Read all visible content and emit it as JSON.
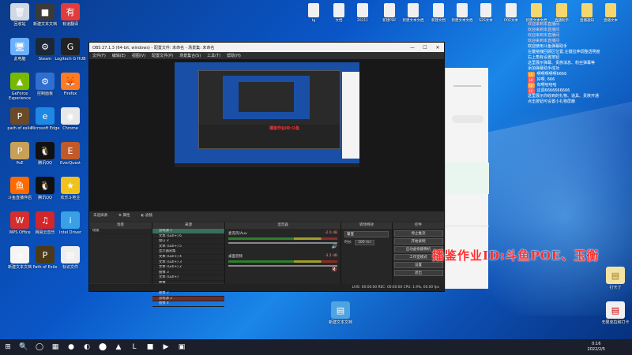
{
  "desktop_left": [
    {
      "label": "回收站",
      "color": "#cfd8e3",
      "glyph": "🗑"
    },
    {
      "label": "新建文本文档",
      "color": "#3a3a3a",
      "glyph": "■"
    },
    {
      "label": "有道翻译",
      "color": "#e23b3b",
      "glyph": "有"
    },
    {
      "label": "此电脑",
      "color": "#6ab0ff",
      "glyph": "🖥"
    },
    {
      "label": "Steam",
      "color": "#1b2838",
      "glyph": "⚙"
    },
    {
      "label": "Logitech G HUB",
      "color": "#222",
      "glyph": "G"
    },
    {
      "label": "GeForce Experience",
      "color": "#76b900",
      "glyph": "▲"
    },
    {
      "label": "控制面板",
      "color": "#2f6fd0",
      "glyph": "⚙"
    },
    {
      "label": "Firefox",
      "color": "#ff7b22",
      "glyph": "🦊"
    },
    {
      "label": "path of exile",
      "color": "#6b4a2a",
      "glyph": "P"
    },
    {
      "label": "Microsoft Edge",
      "color": "#1e88e5",
      "glyph": "e"
    },
    {
      "label": "Chrome",
      "color": "#e8e8e8",
      "glyph": "◉"
    },
    {
      "label": "PoE",
      "color": "#c9a05a",
      "glyph": "P"
    },
    {
      "label": "腾讯QQ",
      "color": "#111",
      "glyph": "🐧"
    },
    {
      "label": "EverQuest",
      "color": "#c05a2a",
      "glyph": "E"
    },
    {
      "label": "斗鱼直播伴侣",
      "color": "#ff6a00",
      "glyph": "鱼"
    },
    {
      "label": "腾讯QQ",
      "color": "#111",
      "glyph": "🐧"
    },
    {
      "label": "欢乐斗地主",
      "color": "#f2c21c",
      "glyph": "★"
    },
    {
      "label": "WPS Office",
      "color": "#d32f2f",
      "glyph": "W"
    },
    {
      "label": "网易云音乐",
      "color": "#d2262d",
      "glyph": "♫"
    },
    {
      "label": "Intel Driver",
      "color": "#3aa0e6",
      "glyph": "i"
    },
    {
      "label": "新建文本文档",
      "color": "#f5f5f5",
      "glyph": "e"
    },
    {
      "label": "Path of Exile",
      "color": "#4a3a1a",
      "glyph": "P"
    },
    {
      "label": "标识文件",
      "color": "#eee",
      "glyph": "▤"
    }
  ],
  "desktop_top": [
    "tg",
    "文档",
    "20211",
    "新建PDF",
    "新建文本文档",
    "新建文档",
    "新建文本文档",
    "S2S文本",
    "POE文本",
    "新建文本文档",
    "直播助手",
    "直播通知",
    "直播文本",
    "直播文件"
  ],
  "obs": {
    "title": "OBS 27.1.3 (64-bit, windows) - 配置文件: 未命名 - 场景集: 未命名",
    "menu": [
      "文件(F)",
      "编辑(E)",
      "视图(V)",
      "配置文件(P)",
      "场景集合(S)",
      "工具(T)",
      "帮助(H)"
    ],
    "preview_label": "未选择源",
    "preview_btns": [
      "属性",
      "滤镜"
    ],
    "panes": {
      "scenes": {
        "title": "场景",
        "items": [
          "场景"
        ]
      },
      "sources": {
        "title": "来源",
        "items": [
          "游戏源 1",
          "文本 (GDI+) 6",
          "窗口 2",
          "文本 (GDI+) 5",
          "显示器采集",
          "文本 (GDI+) 4",
          "文本 (GDI+) 3",
          "文本 (GDI+) 2",
          "图像 3",
          "文本 (GDI+)",
          "图像",
          "显示器采集",
          "图像 2",
          "游戏源 2",
          "图像 4"
        ]
      },
      "mixer": {
        "title": "混音器",
        "tracks": [
          {
            "name": "麦克风/Aux",
            "db": "-2.0 dB"
          },
          {
            "name": "桌面音频",
            "db": "-3.2 dB"
          }
        ]
      },
      "transitions": {
        "title": "转场特效",
        "type": "渐变",
        "duration_label": "时长",
        "duration": "300 ms"
      },
      "controls": {
        "title": "控件",
        "buttons": [
          "停止推流",
          "开始录制",
          "启动虚拟摄像机",
          "工作室模式",
          "设置",
          "退出"
        ]
      }
    },
    "status": "LIVE: 00:00:00    REC: 00:00:00    CPU: 1.9%, 60.00 fps"
  },
  "chat": {
    "lines": [
      {
        "badge": "",
        "user": "",
        "text": "欢迎来到本直播间"
      },
      {
        "badge": "",
        "user": "",
        "text": "欢迎来到本直播间"
      },
      {
        "badge": "",
        "user": "",
        "text": "欢迎来到本直播间"
      },
      {
        "badge": "",
        "user": "",
        "text": "欢迎来到本直播间"
      },
      {
        "badge": "",
        "user": "",
        "text": ""
      },
      {
        "badge": "",
        "user": "",
        "text": "欢迎使用斗鱼弹幕助手"
      },
      {
        "badge": "",
        "user": "",
        "text": "左键拖拽回顾区位置,左键拉伸调整透明度"
      },
      {
        "badge": "",
        "user": "",
        "text": "右上角有设置按钮"
      },
      {
        "badge": "",
        "user": "",
        "text": "这里展示弹幕、贵族消息、粉丝弹幕等"
      },
      {
        "badge": "",
        "user": "",
        "text": "添加弹幕助手成功"
      },
      {
        "badge": "LV",
        "user": "",
        "text": "啊啊啊啊啊6666"
      },
      {
        "badge": "LV",
        "user": "",
        "text": "好啊, 666"
      },
      {
        "badge": "LV",
        "user": "",
        "text": "有啊哈哈哈"
      },
      {
        "badge": "LV",
        "user": "",
        "text": "这调6666666666"
      },
      {
        "badge": "",
        "user": "",
        "text": ""
      },
      {
        "badge": "",
        "user": "",
        "text": "这里展示你收到的礼物、道具、贵族开通"
      },
      {
        "badge": "",
        "user": "",
        "text": "点击按钮可设置小礼物屏蔽"
      }
    ]
  },
  "watermark": "播鉴作业ID:斗鱼POE、玉衡",
  "desktop_right": [
    {
      "label": "打卡了"
    },
    {
      "label": "无限克拉和打卡"
    }
  ],
  "center_file": {
    "label": "新建文本文档"
  },
  "taskbar": {
    "items": [
      "⊞",
      "🔍",
      "◯",
      "▦",
      "●",
      "◐",
      "⬤",
      "▲",
      "L",
      "■",
      "▶",
      "▣"
    ],
    "time": "0:16",
    "date": "2022/2/5"
  },
  "colors": {
    "accent": "#0a56c8",
    "watermark": "#ff2d2d",
    "obs_bg": "#2b2b2b"
  }
}
